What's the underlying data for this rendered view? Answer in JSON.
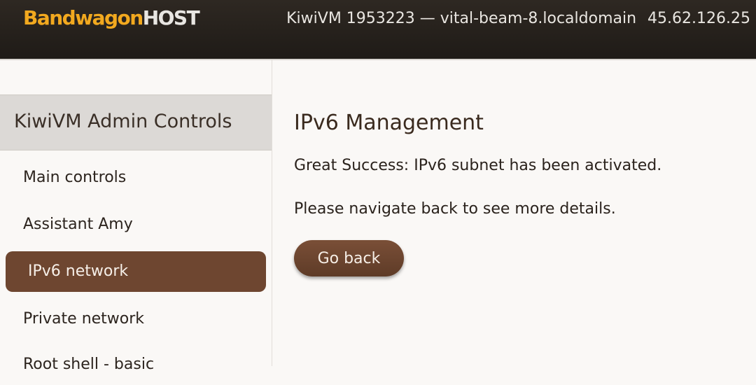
{
  "header": {
    "logo_brand": "Bandwagon",
    "logo_host": "HOST",
    "vm_title": "KiwiVM 1953223 — vital-beam-8.localdomain",
    "ip": "45.62.126.25"
  },
  "sidebar": {
    "heading": "KiwiVM Admin Controls",
    "items": [
      {
        "label": "Main controls",
        "active": false
      },
      {
        "label": "Assistant Amy",
        "active": false
      },
      {
        "label": "IPv6 network",
        "active": true
      },
      {
        "label": "Private network",
        "active": false
      },
      {
        "label": "Root shell - basic",
        "active": false
      }
    ]
  },
  "main": {
    "title": "IPv6 Management",
    "success_message": "Great Success: IPv6 subnet has been activated.",
    "navigate_message": "Please navigate back to see more details.",
    "go_back_label": "Go back"
  }
}
